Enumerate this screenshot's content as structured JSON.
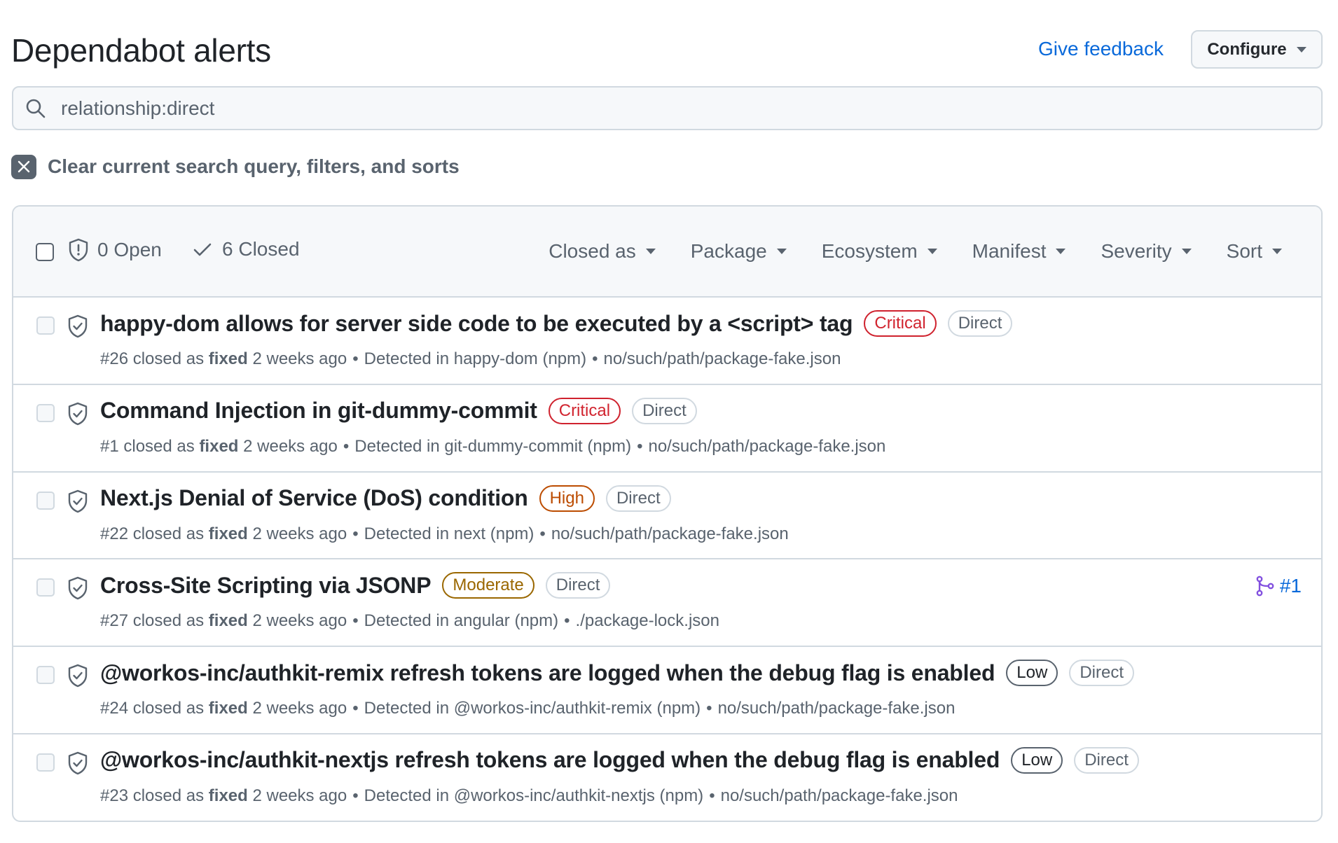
{
  "header": {
    "title": "Dependabot alerts",
    "feedback_link": "Give feedback",
    "configure_button": "Configure"
  },
  "search": {
    "value": "relationship:direct",
    "icon": "search-icon"
  },
  "clear_filters": {
    "label": "Clear current search query, filters, and sorts",
    "icon": "x-icon"
  },
  "list_header": {
    "open_label": "0 Open",
    "closed_label": "6 Closed",
    "filters": [
      {
        "label": "Closed as"
      },
      {
        "label": "Package"
      },
      {
        "label": "Ecosystem"
      },
      {
        "label": "Manifest"
      },
      {
        "label": "Severity"
      },
      {
        "label": "Sort"
      }
    ]
  },
  "colors": {
    "critical": "#cf222e",
    "high": "#bc4c00",
    "moderate": "#9a6700",
    "low": "#59636e",
    "link": "#0969da",
    "merged": "#8250df"
  },
  "alerts": [
    {
      "title": "happy-dom allows for server side code to be executed by a <script> tag",
      "severity": "Critical",
      "severity_class": "critical",
      "relationship": "Direct",
      "number": "#26",
      "closed_prefix": "closed as",
      "closed_reason": "fixed",
      "time": "2 weeks ago",
      "detected": "Detected in happy-dom (npm)",
      "manifest": "no/such/path/package-fake.json",
      "pr": null
    },
    {
      "title": "Command Injection in git-dummy-commit",
      "severity": "Critical",
      "severity_class": "critical",
      "relationship": "Direct",
      "number": "#1",
      "closed_prefix": "closed as",
      "closed_reason": "fixed",
      "time": "2 weeks ago",
      "detected": "Detected in git-dummy-commit (npm)",
      "manifest": "no/such/path/package-fake.json",
      "pr": null
    },
    {
      "title": "Next.js Denial of Service (DoS) condition",
      "severity": "High",
      "severity_class": "high",
      "relationship": "Direct",
      "number": "#22",
      "closed_prefix": "closed as",
      "closed_reason": "fixed",
      "time": "2 weeks ago",
      "detected": "Detected in next (npm)",
      "manifest": "no/such/path/package-fake.json",
      "pr": null
    },
    {
      "title": "Cross-Site Scripting via JSONP",
      "severity": "Moderate",
      "severity_class": "moderate",
      "relationship": "Direct",
      "number": "#27",
      "closed_prefix": "closed as",
      "closed_reason": "fixed",
      "time": "2 weeks ago",
      "detected": "Detected in angular (npm)",
      "manifest": "./package-lock.json",
      "pr": "#1"
    },
    {
      "title": "@workos-inc/authkit-remix refresh tokens are logged when the debug flag is enabled",
      "severity": "Low",
      "severity_class": "low",
      "relationship": "Direct",
      "number": "#24",
      "closed_prefix": "closed as",
      "closed_reason": "fixed",
      "time": "2 weeks ago",
      "detected": "Detected in @workos-inc/authkit-remix (npm)",
      "manifest": "no/such/path/package-fake.json",
      "pr": null
    },
    {
      "title": "@workos-inc/authkit-nextjs refresh tokens are logged when the debug flag is enabled",
      "severity": "Low",
      "severity_class": "low",
      "relationship": "Direct",
      "number": "#23",
      "closed_prefix": "closed as",
      "closed_reason": "fixed",
      "time": "2 weeks ago",
      "detected": "Detected in @workos-inc/authkit-nextjs (npm)",
      "manifest": "no/such/path/package-fake.json",
      "pr": null
    }
  ]
}
